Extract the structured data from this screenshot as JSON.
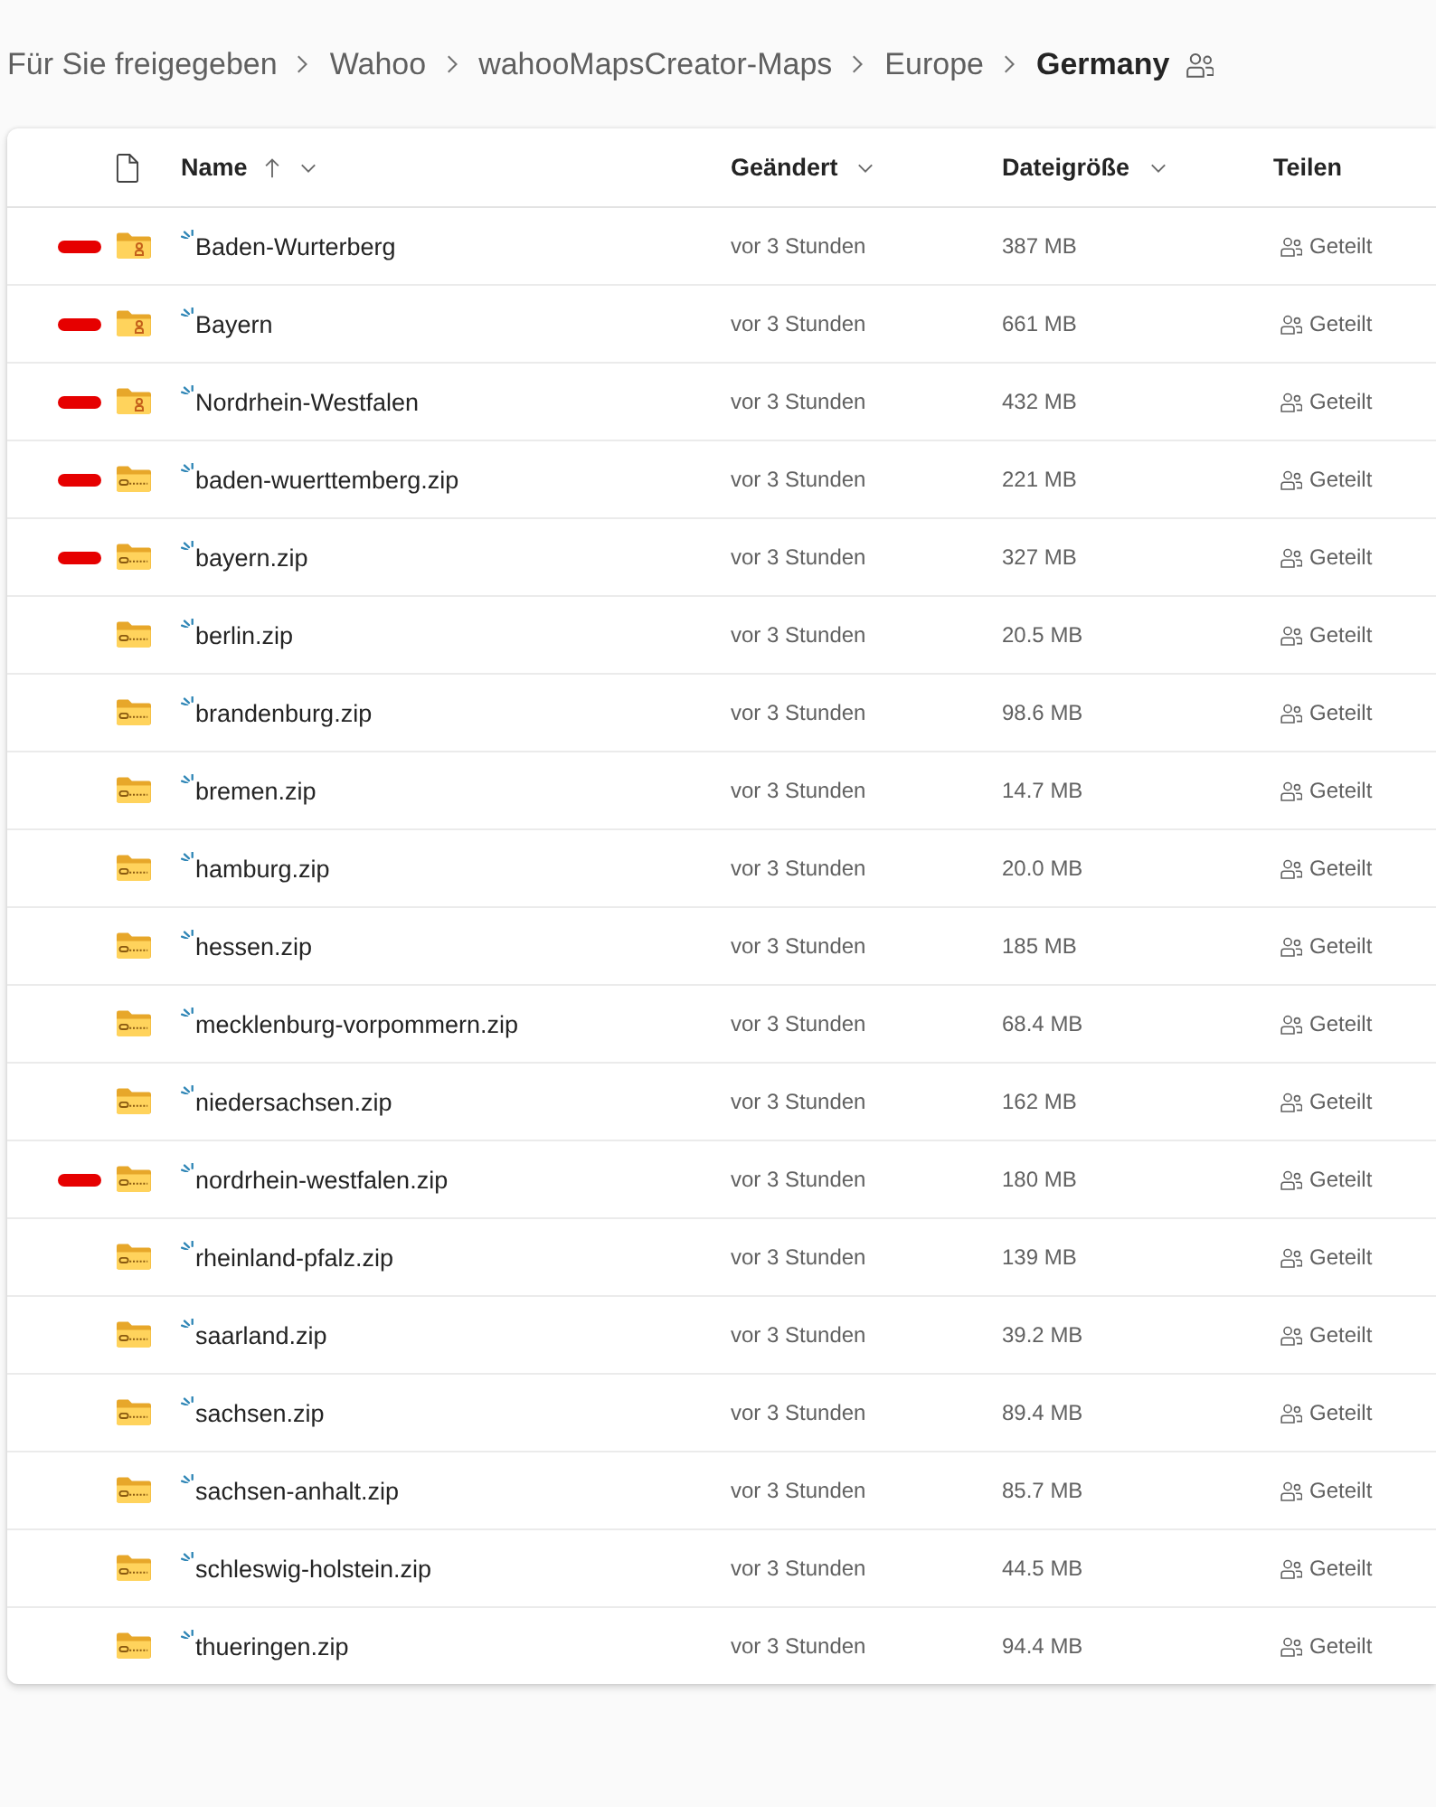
{
  "breadcrumb": [
    {
      "label": "Für Sie freigegeben",
      "current": false
    },
    {
      "label": "Wahoo",
      "current": false
    },
    {
      "label": "wahooMapsCreator-Maps",
      "current": false
    },
    {
      "label": "Europe",
      "current": false
    },
    {
      "label": "Germany",
      "current": true,
      "shared": true
    }
  ],
  "table": {
    "columns": [
      {
        "kind": "type-icon"
      },
      {
        "kind": "text",
        "label": "Name",
        "sorted": true,
        "menu": true
      },
      {
        "kind": "text",
        "label": "Geändert",
        "sorted": false,
        "menu": true
      },
      {
        "kind": "text",
        "label": "Dateigröße",
        "sorted": false,
        "menu": true
      },
      {
        "kind": "text",
        "label": "Teilen",
        "sorted": false,
        "menu": false
      }
    ],
    "rows": [
      {
        "kind": "shared-folder",
        "name": "Baden-Wurterberg",
        "new": true,
        "modified": "vor 3 Stunden",
        "size": "387 MB",
        "sharing": "Geteilt",
        "marked": true
      },
      {
        "kind": "shared-folder",
        "name": "Bayern",
        "new": true,
        "modified": "vor 3 Stunden",
        "size": "661 MB",
        "sharing": "Geteilt",
        "marked": true
      },
      {
        "kind": "shared-folder",
        "name": "Nordrhein-Westfalen",
        "new": true,
        "modified": "vor 3 Stunden",
        "size": "432 MB",
        "sharing": "Geteilt",
        "marked": true
      },
      {
        "kind": "zip",
        "name": "baden-wuerttemberg.zip",
        "new": true,
        "modified": "vor 3 Stunden",
        "size": "221 MB",
        "sharing": "Geteilt",
        "marked": true
      },
      {
        "kind": "zip",
        "name": "bayern.zip",
        "new": true,
        "modified": "vor 3 Stunden",
        "size": "327 MB",
        "sharing": "Geteilt",
        "marked": true
      },
      {
        "kind": "zip",
        "name": "berlin.zip",
        "new": true,
        "modified": "vor 3 Stunden",
        "size": "20.5 MB",
        "sharing": "Geteilt",
        "marked": false
      },
      {
        "kind": "zip",
        "name": "brandenburg.zip",
        "new": true,
        "modified": "vor 3 Stunden",
        "size": "98.6 MB",
        "sharing": "Geteilt",
        "marked": false
      },
      {
        "kind": "zip",
        "name": "bremen.zip",
        "new": true,
        "modified": "vor 3 Stunden",
        "size": "14.7 MB",
        "sharing": "Geteilt",
        "marked": false
      },
      {
        "kind": "zip",
        "name": "hamburg.zip",
        "new": true,
        "modified": "vor 3 Stunden",
        "size": "20.0 MB",
        "sharing": "Geteilt",
        "marked": false
      },
      {
        "kind": "zip",
        "name": "hessen.zip",
        "new": true,
        "modified": "vor 3 Stunden",
        "size": "185 MB",
        "sharing": "Geteilt",
        "marked": false
      },
      {
        "kind": "zip",
        "name": "mecklenburg-vorpommern.zip",
        "new": true,
        "modified": "vor 3 Stunden",
        "size": "68.4 MB",
        "sharing": "Geteilt",
        "marked": false
      },
      {
        "kind": "zip",
        "name": "niedersachsen.zip",
        "new": true,
        "modified": "vor 3 Stunden",
        "size": "162 MB",
        "sharing": "Geteilt",
        "marked": false
      },
      {
        "kind": "zip",
        "name": "nordrhein-westfalen.zip",
        "new": true,
        "modified": "vor 3 Stunden",
        "size": "180 MB",
        "sharing": "Geteilt",
        "marked": true
      },
      {
        "kind": "zip",
        "name": "rheinland-pfalz.zip",
        "new": true,
        "modified": "vor 3 Stunden",
        "size": "139 MB",
        "sharing": "Geteilt",
        "marked": false
      },
      {
        "kind": "zip",
        "name": "saarland.zip",
        "new": true,
        "modified": "vor 3 Stunden",
        "size": "39.2 MB",
        "sharing": "Geteilt",
        "marked": false
      },
      {
        "kind": "zip",
        "name": "sachsen.zip",
        "new": true,
        "modified": "vor 3 Stunden",
        "size": "89.4 MB",
        "sharing": "Geteilt",
        "marked": false
      },
      {
        "kind": "zip",
        "name": "sachsen-anhalt.zip",
        "new": true,
        "modified": "vor 3 Stunden",
        "size": "85.7 MB",
        "sharing": "Geteilt",
        "marked": false
      },
      {
        "kind": "zip",
        "name": "schleswig-holstein.zip",
        "new": true,
        "modified": "vor 3 Stunden",
        "size": "44.5 MB",
        "sharing": "Geteilt",
        "marked": false
      },
      {
        "kind": "zip",
        "name": "thueringen.zip",
        "new": true,
        "modified": "vor 3 Stunden",
        "size": "94.4 MB",
        "sharing": "Geteilt",
        "marked": false
      }
    ]
  }
}
